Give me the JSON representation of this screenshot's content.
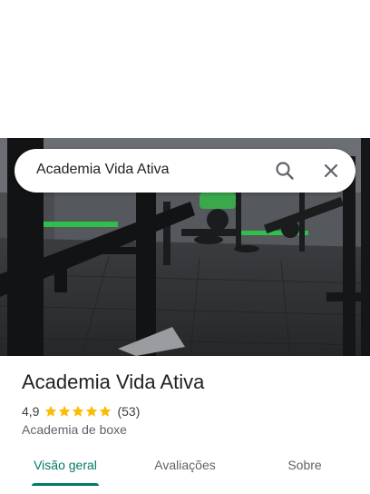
{
  "search": {
    "query": "Academia Vida Ativa"
  },
  "place": {
    "name": "Academia Vida Ativa",
    "rating": "4,9",
    "stars": 5,
    "review_count": "(53)",
    "category": "Academia de boxe"
  },
  "tabs": [
    {
      "label": "Visão geral",
      "active": true
    },
    {
      "label": "Avaliações",
      "active": false
    },
    {
      "label": "Sobre",
      "active": false
    }
  ],
  "colors": {
    "accent": "#00796b",
    "star": "#fbbc04",
    "text_secondary": "#5f6368"
  },
  "icons": {
    "search": "search-icon",
    "close": "close-icon",
    "star": "star-icon"
  }
}
